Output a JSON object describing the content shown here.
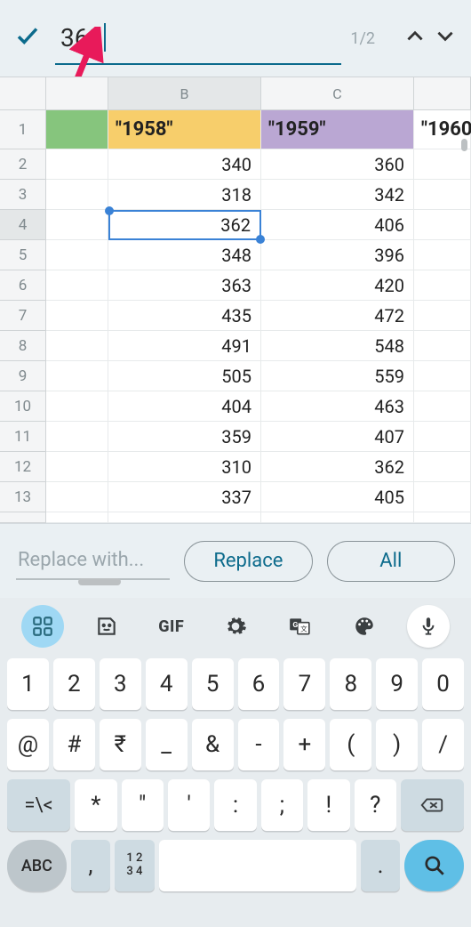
{
  "search": {
    "value": "362",
    "matches": "1/2"
  },
  "columns": [
    "B",
    "C"
  ],
  "headers": {
    "b": "\"1958\"",
    "c": "\"1959\"",
    "d": "\"1960\""
  },
  "rows": [
    {
      "n": 1
    },
    {
      "n": 2,
      "b": "340",
      "c": "360"
    },
    {
      "n": 3,
      "b": "318",
      "c": "342"
    },
    {
      "n": 4,
      "b": "362",
      "c": "406",
      "sel": true
    },
    {
      "n": 5,
      "b": "348",
      "c": "396"
    },
    {
      "n": 6,
      "b": "363",
      "c": "420"
    },
    {
      "n": 7,
      "b": "435",
      "c": "472"
    },
    {
      "n": 8,
      "b": "491",
      "c": "548"
    },
    {
      "n": 9,
      "b": "505",
      "c": "559"
    },
    {
      "n": 10,
      "b": "404",
      "c": "463"
    },
    {
      "n": 11,
      "b": "359",
      "c": "407"
    },
    {
      "n": 12,
      "b": "310",
      "c": "362"
    },
    {
      "n": 13,
      "b": "337",
      "c": "405"
    }
  ],
  "replace": {
    "placeholder": "Replace with...",
    "replace_label": "Replace",
    "all_label": "All"
  },
  "keyboard": {
    "row1": [
      "1",
      "2",
      "3",
      "4",
      "5",
      "6",
      "7",
      "8",
      "9",
      "0"
    ],
    "row2": [
      "@",
      "#",
      "₹",
      "_",
      "&",
      "-",
      "+",
      "(",
      ")",
      "/"
    ],
    "row3_shift": "=\\<",
    "row3": [
      "*",
      "\"",
      "'",
      ":",
      ";",
      "!",
      "?"
    ],
    "abc": "ABC",
    "comma": ",",
    "num": "1 2\n3 4",
    "dot": "."
  }
}
